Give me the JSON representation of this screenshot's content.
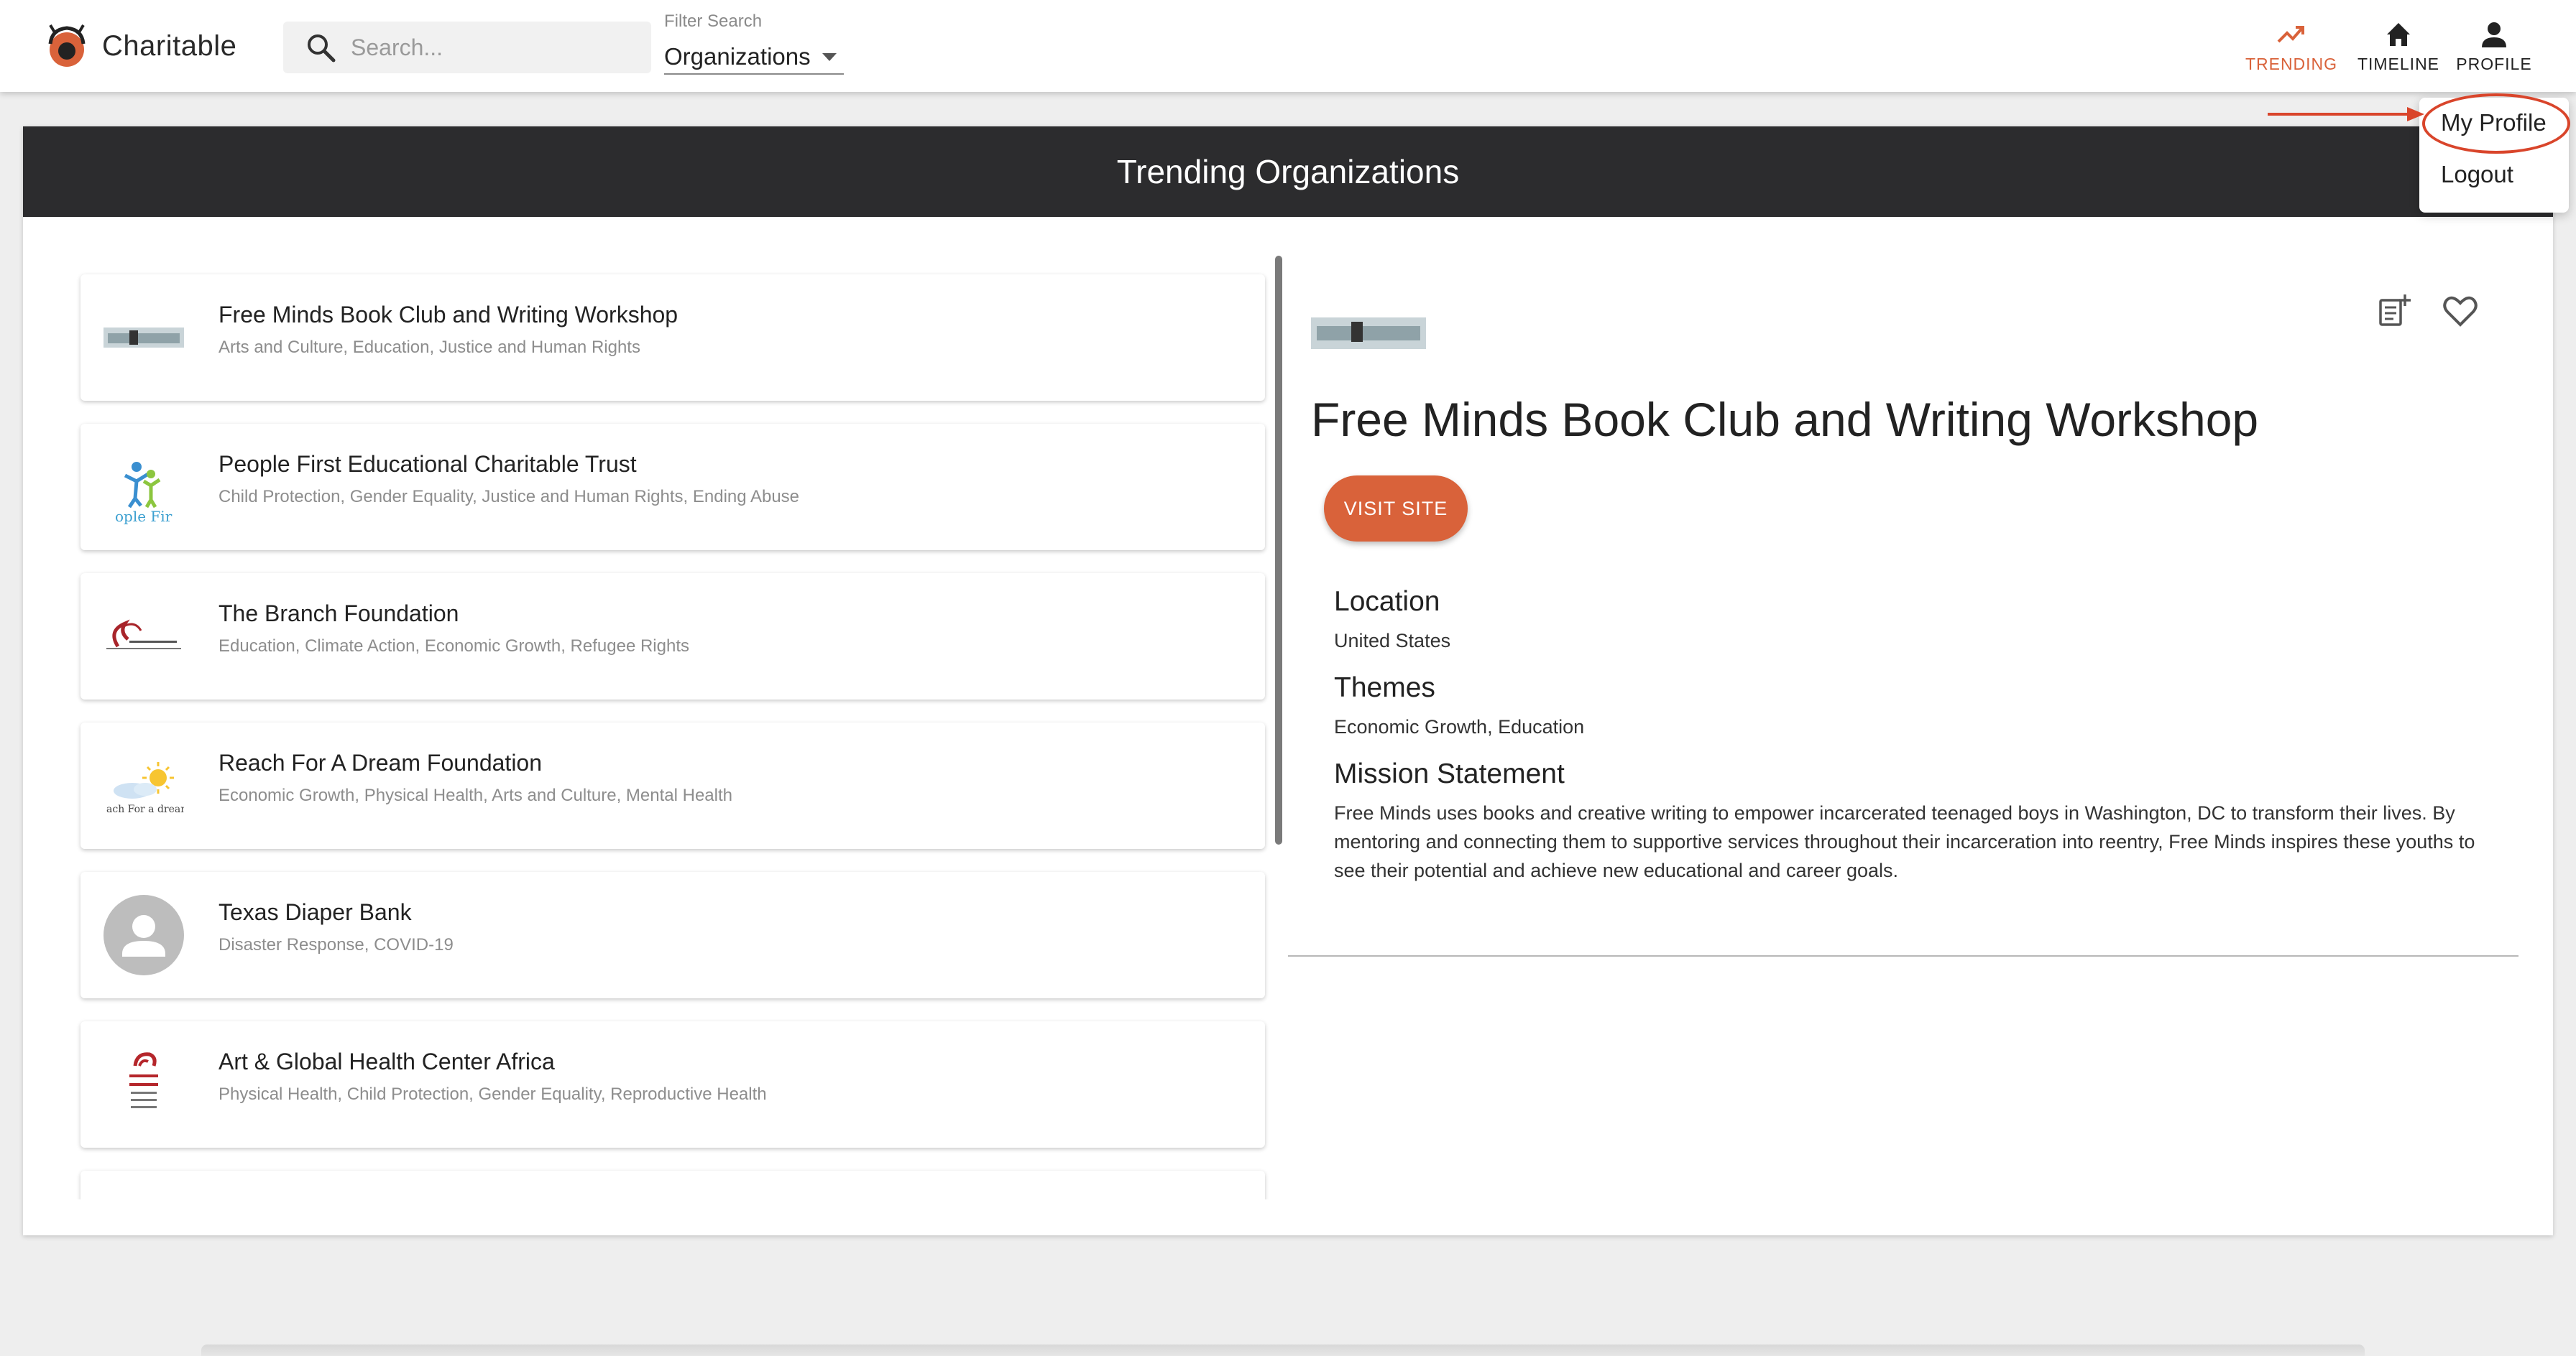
{
  "app": {
    "name": "Charitable"
  },
  "search": {
    "placeholder": "Search..."
  },
  "filter": {
    "label": "Filter Search",
    "value": "Organizations"
  },
  "nav": [
    {
      "label": "TRENDING",
      "icon": "trending-up-icon",
      "active": true
    },
    {
      "label": "TIMELINE",
      "icon": "home-icon",
      "active": false
    },
    {
      "label": "PROFILE",
      "icon": "person-icon",
      "active": false
    }
  ],
  "profile_menu": {
    "items": [
      "My Profile",
      "Logout"
    ]
  },
  "banner": {
    "title": "Trending Organizations"
  },
  "organizations": [
    {
      "name": "Free Minds Book Club and Writing Workshop",
      "tags": "Arts and Culture, Education, Justice and Human Rights",
      "logo": "free-minds-logo"
    },
    {
      "name": "People First Educational Charitable Trust",
      "tags": "Child Protection, Gender Equality, Justice and Human Rights, Ending Abuse",
      "logo": "people-first-logo",
      "logo_text": "ople Fir"
    },
    {
      "name": "The Branch Foundation",
      "tags": "Education, Climate Action, Economic Growth, Refugee Rights",
      "logo": "branch-foundation-logo"
    },
    {
      "name": "Reach For A Dream Foundation",
      "tags": "Economic Growth, Physical Health, Arts and Culture, Mental Health",
      "logo": "reach-for-a-dream-logo",
      "logo_text": "ach For a dream"
    },
    {
      "name": "Texas Diaper Bank",
      "tags": "Disaster Response, COVID-19",
      "logo": "default-avatar-icon"
    },
    {
      "name": "Art & Global Health Center Africa",
      "tags": "Physical Health, Child Protection, Gender Equality, Reproductive Health",
      "logo": "art-global-health-logo"
    }
  ],
  "detail": {
    "name": "Free Minds Book Club and Writing Workshop",
    "visit_label": "VISIT SITE",
    "location_heading": "Location",
    "location": "United States",
    "themes_heading": "Themes",
    "themes": "Economic Growth, Education",
    "mission_heading": "Mission Statement",
    "mission": "Free Minds uses books and creative writing to empower incarcerated teenaged boys in Washington, DC to transform their lives. By mentoring and connecting them to supportive services throughout their incarceration into reentry, Free Minds inspires these youths to see their potential and achieve new educational and career goals."
  },
  "colors": {
    "accent": "#d9623a",
    "banner": "#2c2c2e",
    "annotation": "#d9452b"
  }
}
